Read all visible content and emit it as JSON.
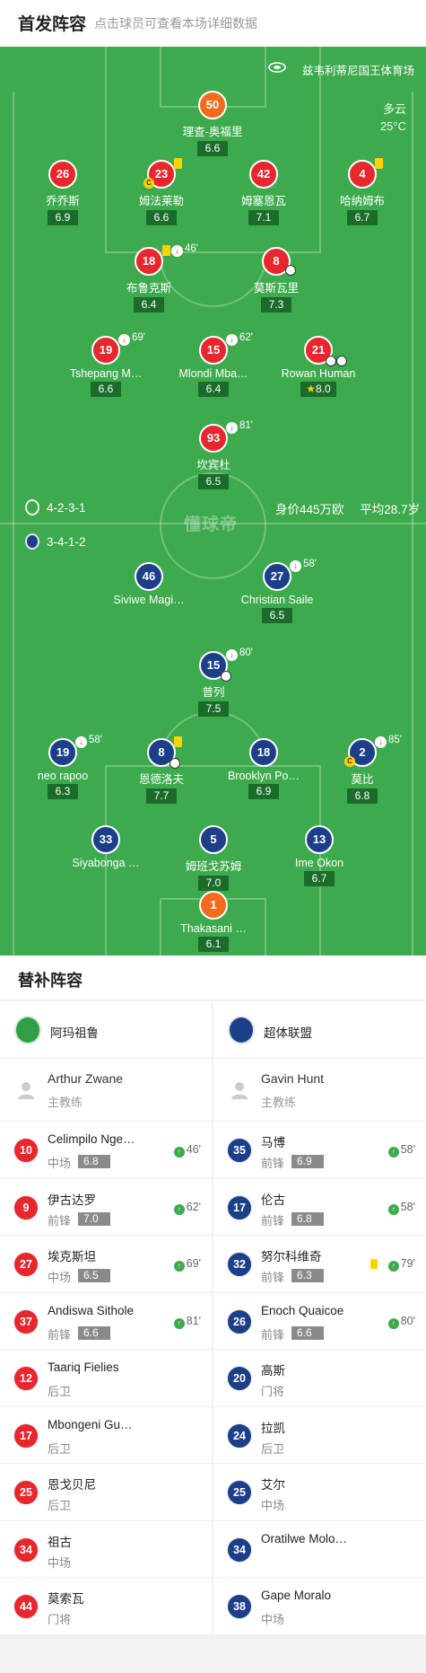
{
  "header": {
    "title": "首发阵容",
    "subtitle": "点击球员可查看本场详细数据"
  },
  "venue": "兹韦利蒂尼国王体育场",
  "weather": {
    "condition": "多云",
    "temp": "25°C"
  },
  "watermark": "懂球帝",
  "home_formation": "4-2-3-1",
  "away_formation": "3-4-1-2",
  "value_info": {
    "value": "身价445万欧",
    "age": "平均28.7岁"
  },
  "home_players": [
    {
      "num": "50",
      "name": "理查-奥福里",
      "rating": "6.6",
      "gk": true
    },
    {
      "num": "26",
      "name": "乔乔斯",
      "rating": "6.9"
    },
    {
      "num": "23",
      "name": "姆法莱勒",
      "rating": "6.6"
    },
    {
      "num": "42",
      "name": "姆塞恩瓦",
      "rating": "7.1"
    },
    {
      "num": "4",
      "name": "哈纳姆布",
      "rating": "6.7"
    },
    {
      "num": "18",
      "name": "布鲁克斯",
      "rating": "6.4",
      "sub_min": "46'"
    },
    {
      "num": "8",
      "name": "莫斯瓦里",
      "rating": "7.3"
    },
    {
      "num": "19",
      "name": "Tshepang M…",
      "rating": "6.6",
      "sub_min": "69'"
    },
    {
      "num": "15",
      "name": "Mlondi Mba…",
      "rating": "6.4",
      "sub_min": "62'"
    },
    {
      "num": "21",
      "name": "Rowan Human",
      "rating": "8.0"
    },
    {
      "num": "93",
      "name": "坎宾杜",
      "rating": "6.5",
      "sub_min": "81'"
    }
  ],
  "away_players": [
    {
      "num": "46",
      "name": "Siviwe Magi…",
      "rating": ""
    },
    {
      "num": "27",
      "name": "Christian Saile",
      "rating": "6.5",
      "sub_min": "58'"
    },
    {
      "num": "15",
      "name": "普列",
      "rating": "7.5",
      "sub_min": "80'"
    },
    {
      "num": "19",
      "name": "neo rapoo",
      "rating": "6.3",
      "sub_min": "58'"
    },
    {
      "num": "8",
      "name": "恩德洛夫",
      "rating": "7.7"
    },
    {
      "num": "18",
      "name": "Brooklyn Po…",
      "rating": "6.9"
    },
    {
      "num": "2",
      "name": "莫比",
      "rating": "6.8",
      "sub_min": "85'"
    },
    {
      "num": "33",
      "name": "Siyabonga …",
      "rating": ""
    },
    {
      "num": "5",
      "name": "姆班戈苏姆",
      "rating": "7.0"
    },
    {
      "num": "13",
      "name": "Ime Okon",
      "rating": "6.7"
    },
    {
      "num": "1",
      "name": "Thakasani …",
      "rating": "6.1",
      "gk": true
    }
  ],
  "subs_title": "替补阵容",
  "home_team": {
    "name": "阿玛祖鲁",
    "coach": "Arthur Zwane",
    "coach_role": "主教练",
    "subs": [
      {
        "num": "10",
        "name": "Celimpilo Nge…",
        "pos": "中场",
        "rating": "6.8",
        "in": "46'"
      },
      {
        "num": "9",
        "name": "伊古达罗",
        "pos": "前锋",
        "rating": "7.0",
        "in": "62'"
      },
      {
        "num": "27",
        "name": "埃克斯坦",
        "pos": "中场",
        "rating": "6.5",
        "in": "69'"
      },
      {
        "num": "37",
        "name": "Andiswa Sithole",
        "pos": "前锋",
        "rating": "6.6",
        "in": "81'"
      },
      {
        "num": "12",
        "name": "Taariq Fielies",
        "pos": "后卫",
        "rating": "",
        "in": ""
      },
      {
        "num": "17",
        "name": "Mbongeni Gu…",
        "pos": "后卫",
        "rating": "",
        "in": ""
      },
      {
        "num": "25",
        "name": "恩戈贝尼",
        "pos": "后卫",
        "rating": "",
        "in": ""
      },
      {
        "num": "34",
        "name": "祖古",
        "pos": "中场",
        "rating": "",
        "in": ""
      },
      {
        "num": "44",
        "name": "莫索瓦",
        "pos": "门将",
        "rating": "",
        "in": ""
      }
    ]
  },
  "away_team": {
    "name": "超体联盟",
    "coach": "Gavin Hunt",
    "coach_role": "主教练",
    "subs": [
      {
        "num": "35",
        "name": "马博",
        "pos": "前锋",
        "rating": "6.9",
        "in": "58'"
      },
      {
        "num": "17",
        "name": "伦古",
        "pos": "前锋",
        "rating": "6.8",
        "in": "58'"
      },
      {
        "num": "32",
        "name": "努尔科维奇",
        "pos": "前锋",
        "rating": "6.3",
        "in": "79'"
      },
      {
        "num": "26",
        "name": "Enoch Quaicoe",
        "pos": "前锋",
        "rating": "6.6",
        "in": "80'"
      },
      {
        "num": "20",
        "name": "高斯",
        "pos": "门将",
        "rating": "",
        "in": ""
      },
      {
        "num": "24",
        "name": "拉凯",
        "pos": "后卫",
        "rating": "",
        "in": ""
      },
      {
        "num": "25",
        "name": "艾尔",
        "pos": "中场",
        "rating": "",
        "in": ""
      },
      {
        "num": "34",
        "name": "Oratilwe Molo…",
        "pos": "",
        "rating": "",
        "in": ""
      },
      {
        "num": "38",
        "name": "Gape Moralo",
        "pos": "中场",
        "rating": "",
        "in": ""
      }
    ]
  }
}
